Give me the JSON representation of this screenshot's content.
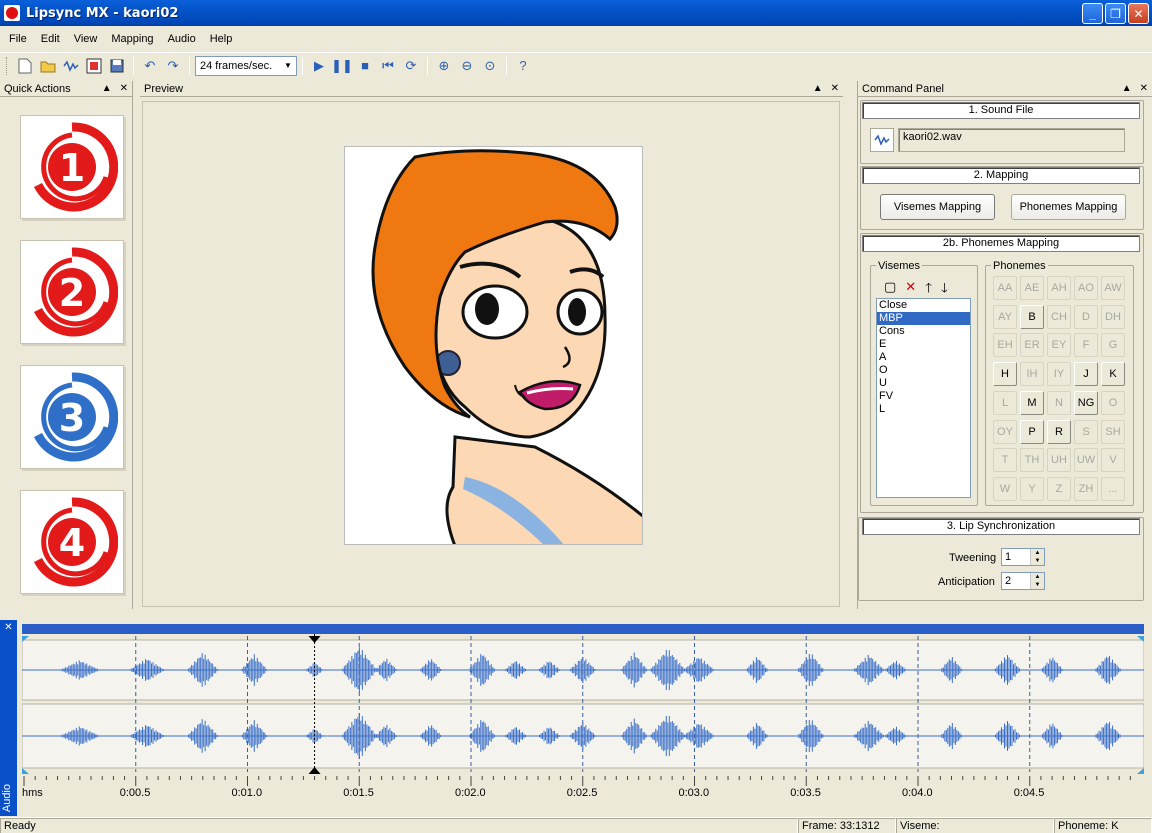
{
  "window": {
    "title": "Lipsync MX - kaori02"
  },
  "menu": [
    "File",
    "Edit",
    "View",
    "Mapping",
    "Audio",
    "Help"
  ],
  "toolbar": {
    "fps": "24 frames/sec."
  },
  "quick_actions": {
    "title": "Quick Actions",
    "tiles": [
      "1",
      "2",
      "3",
      "4"
    ],
    "tile_colors": [
      "#e21a1a",
      "#e21a1a",
      "#2f6fc8",
      "#e21a1a"
    ]
  },
  "preview": {
    "title": "Preview"
  },
  "command_panel": {
    "title": "Command Panel",
    "sound_file": {
      "heading": "1. Sound File",
      "file": "kaori02.wav"
    },
    "mapping": {
      "heading": "2. Mapping",
      "visemes_btn": "Visemes Mapping",
      "phonemes_btn": "Phonemes Mapping"
    },
    "phonemes_mapping": {
      "heading": "2b. Phonemes Mapping",
      "visemes_label": "Visemes",
      "phonemes_label": "Phonemes",
      "visemes": [
        "Close",
        "MBP",
        "Cons",
        "E",
        "A",
        "O",
        "U",
        "FV",
        "L"
      ],
      "selected_viseme": "MBP",
      "phonemes": [
        "AA",
        "AE",
        "AH",
        "AO",
        "AW",
        "AY",
        "B",
        "CH",
        "D",
        "DH",
        "EH",
        "ER",
        "EY",
        "F",
        "G",
        "H",
        "IH",
        "IY",
        "J",
        "K",
        "L",
        "M",
        "N",
        "NG",
        "O",
        "OY",
        "P",
        "R",
        "S",
        "SH",
        "T",
        "TH",
        "UH",
        "UW",
        "V",
        "W",
        "Y",
        "Z",
        "ZH",
        "..."
      ],
      "active_phonemes": [
        "B",
        "H",
        "J",
        "K",
        "M",
        "NG",
        "P",
        "R"
      ]
    },
    "lip_sync": {
      "heading": "3. Lip Synchronization",
      "tweening_label": "Tweening",
      "tweening": "1",
      "anticipation_label": "Anticipation",
      "anticipation": "2"
    }
  },
  "audio": {
    "label": "Audio",
    "time_labels": [
      "hms",
      "0:00.5",
      "0:01.0",
      "0:01.5",
      "0:02.0",
      "0:02.5",
      "0:03.0",
      "0:03.5",
      "0:04.0",
      "0:04.5"
    ],
    "waveform_color": "#3a6fc8",
    "playhead_time_s": 1.3
  },
  "status": {
    "ready": "Ready",
    "frame": "Frame: 33:1312",
    "viseme": "Viseme:",
    "phoneme": "Phoneme: K"
  },
  "colors": {
    "titlebar": "#0453c8",
    "selection": "#316ac5",
    "panel_bg": "#ece9d8"
  }
}
